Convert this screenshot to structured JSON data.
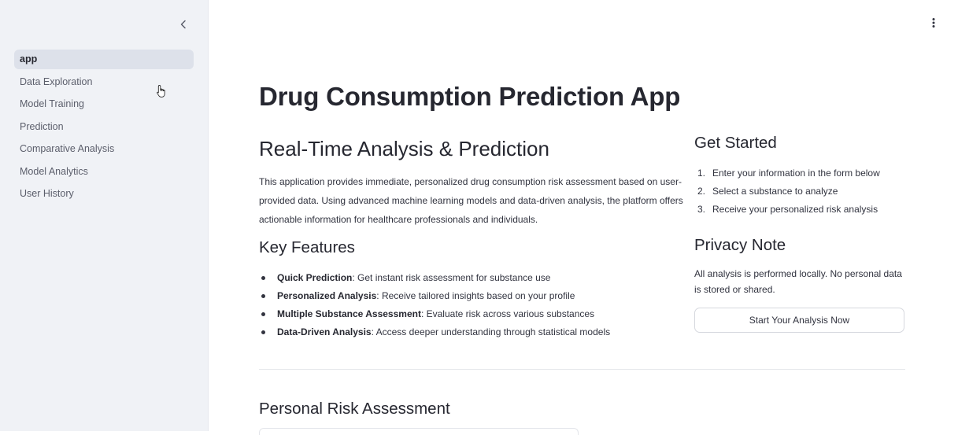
{
  "sidebar": {
    "items": [
      {
        "label": "app",
        "active": true
      },
      {
        "label": "Data Exploration",
        "active": false
      },
      {
        "label": "Model Training",
        "active": false
      },
      {
        "label": "Prediction",
        "active": false
      },
      {
        "label": "Comparative Analysis",
        "active": false
      },
      {
        "label": "Model Analytics",
        "active": false
      },
      {
        "label": "User History",
        "active": false
      }
    ],
    "collapse_icon": "chevron-left-icon"
  },
  "header": {
    "menu_icon": "vertical-dots-icon"
  },
  "main": {
    "title": "Drug Consumption Prediction App",
    "realtime": {
      "heading": "Real-Time Analysis & Prediction",
      "paragraph": "This application provides immediate, personalized drug consumption risk assessment based on user-provided data. Using advanced machine learning models and data-driven analysis, the platform offers actionable information for healthcare professionals and individuals."
    },
    "key_features": {
      "heading": "Key Features",
      "items": [
        {
          "name": "Quick Prediction",
          "desc": ": Get instant risk assessment for substance use"
        },
        {
          "name": "Personalized Analysis",
          "desc": ": Receive tailored insights based on your profile"
        },
        {
          "name": "Multiple Substance Assessment",
          "desc": ": Evaluate risk across various substances"
        },
        {
          "name": "Data-Driven Analysis",
          "desc": ": Access deeper understanding through statistical models"
        }
      ]
    },
    "get_started": {
      "heading": "Get Started",
      "steps": [
        {
          "num": "1.",
          "text": "Enter your information in the form below"
        },
        {
          "num": "2.",
          "text": "Select a substance to analyze"
        },
        {
          "num": "3.",
          "text": "Receive your personalized risk analysis"
        }
      ]
    },
    "privacy": {
      "heading": "Privacy Note",
      "text": "All analysis is performed locally. No personal data is stored or shared."
    },
    "cta_label": "Start Your Analysis Now",
    "personal_risk_heading": "Personal Risk Assessment"
  },
  "colors": {
    "sidebar_bg": "#f0f2f6",
    "active_item_bg": "#dde1ea",
    "text": "#31333f",
    "heading": "#262730"
  }
}
